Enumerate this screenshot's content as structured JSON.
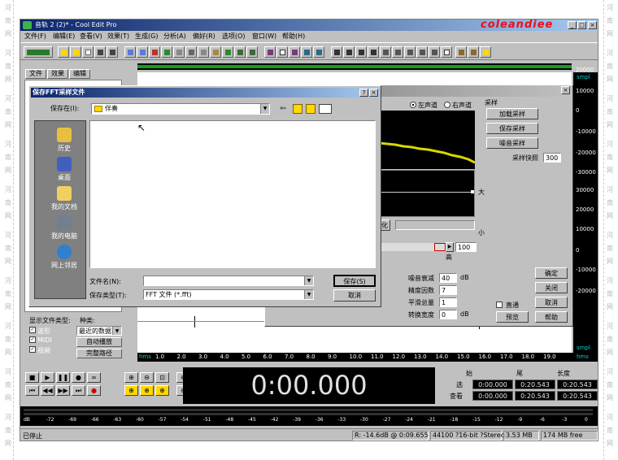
{
  "watermark_char_left": [
    "河",
    "南",
    "网"
  ],
  "app": {
    "title": "音轨 2 (2)* - Cool Edit Pro",
    "brand": "coleandiee",
    "menus": [
      "文件(F)",
      "编辑(E)",
      "查看(V)",
      "效果(T)",
      "生成(G)",
      "分析(A)",
      "偏好(R)",
      "选项(O)",
      "窗口(W)",
      "帮助(H)"
    ],
    "window_buttons": [
      "_",
      "□",
      "×"
    ]
  },
  "left_panel": {
    "tabs": [
      "文件",
      "效果",
      "编辑"
    ],
    "show_type_label": "显示文件类型:",
    "sort_label": "种类:",
    "types": [
      "波形",
      "MIDI",
      "视频"
    ],
    "sort_value": "最近的数据",
    "buttons": [
      "自动播放",
      "完整路径"
    ]
  },
  "timeline": {
    "unit": "hms",
    "ticks": [
      "1.0",
      "2.0",
      "3.0",
      "4.0",
      "5.0",
      "6.0",
      "7.0",
      "8.0",
      "9.0",
      "10.0",
      "11.0",
      "12.0",
      "13.0",
      "14.0",
      "15.0",
      "16.0",
      "17.0",
      "18.0",
      "19.0"
    ],
    "end_unit": "hms",
    "right_top_label": "smpl",
    "right_bottom_label": "smpl",
    "right_scale": [
      "20000",
      "10000",
      "0",
      "-10000",
      "-20000",
      "-30000",
      "30000",
      "20000",
      "10000",
      "0",
      "-10000",
      "-20000"
    ]
  },
  "time_display": "0:00.000",
  "time_info": {
    "headers": [
      "始",
      "尾",
      "长度"
    ],
    "rows": [
      {
        "label": "选",
        "values": [
          "0:00.000",
          "0:20.543",
          "0:20.543"
        ]
      },
      {
        "label": "查看",
        "values": [
          "0:00.000",
          "0:20.543",
          "0:20.543"
        ]
      }
    ]
  },
  "level_meter": [
    "dB",
    "-72",
    "-69",
    "-66",
    "-63",
    "-60",
    "-57",
    "-54",
    "-51",
    "-48",
    "-45",
    "-42",
    "-39",
    "-36",
    "-33",
    "-30",
    "-27",
    "-24",
    "-21",
    "-18",
    "-15",
    "-12",
    "-9",
    "-6",
    "-3",
    "0"
  ],
  "status": {
    "left": "已停止",
    "cells": [
      "R: -14.6dB @  0:09.655",
      "44100 ?16-bit ?Stereo",
      "3.53 MB",
      "174 MB free"
    ]
  },
  "noise_dialog": {
    "channels": [
      "左声道",
      "右声道"
    ],
    "sample_group": "采样",
    "sample_buttons": [
      "加载采样",
      "保存采样",
      "噪音采样"
    ],
    "snapshot_label": "采样快照",
    "snapshot_value": "300",
    "high_label": "大",
    "low_label": "小",
    "optimize_label": "化",
    "slider_value": "100",
    "slider_label": "高",
    "params": [
      {
        "label": "噪音衰减",
        "value": "40",
        "unit": "dB"
      },
      {
        "label": "精度因数",
        "value": "7",
        "unit": ""
      },
      {
        "label": "平滑总量",
        "value": "1",
        "unit": ""
      },
      {
        "label": "转换宽度",
        "value": "0",
        "unit": "dB"
      }
    ],
    "right_buttons": [
      "确定",
      "关闭",
      "取消",
      "帮助"
    ],
    "bypass_label": "直通",
    "preview_button": "预览",
    "close_x": "×"
  },
  "save_dialog": {
    "title": "保存FFT采样文件",
    "help_btn": "?",
    "close_btn": "×",
    "save_in_label": "保存在(I):",
    "save_in_value": "伴奏",
    "places": [
      "历史",
      "桌面",
      "我的文档",
      "我的电脑",
      "网上邻居"
    ],
    "filename_label": "文件名(N):",
    "filename_value": "",
    "filetype_label": "保存类型(T):",
    "filetype_value": "FFT 文件 (*.fft)",
    "save_button": "保存(S)",
    "cancel_button": "取消"
  }
}
